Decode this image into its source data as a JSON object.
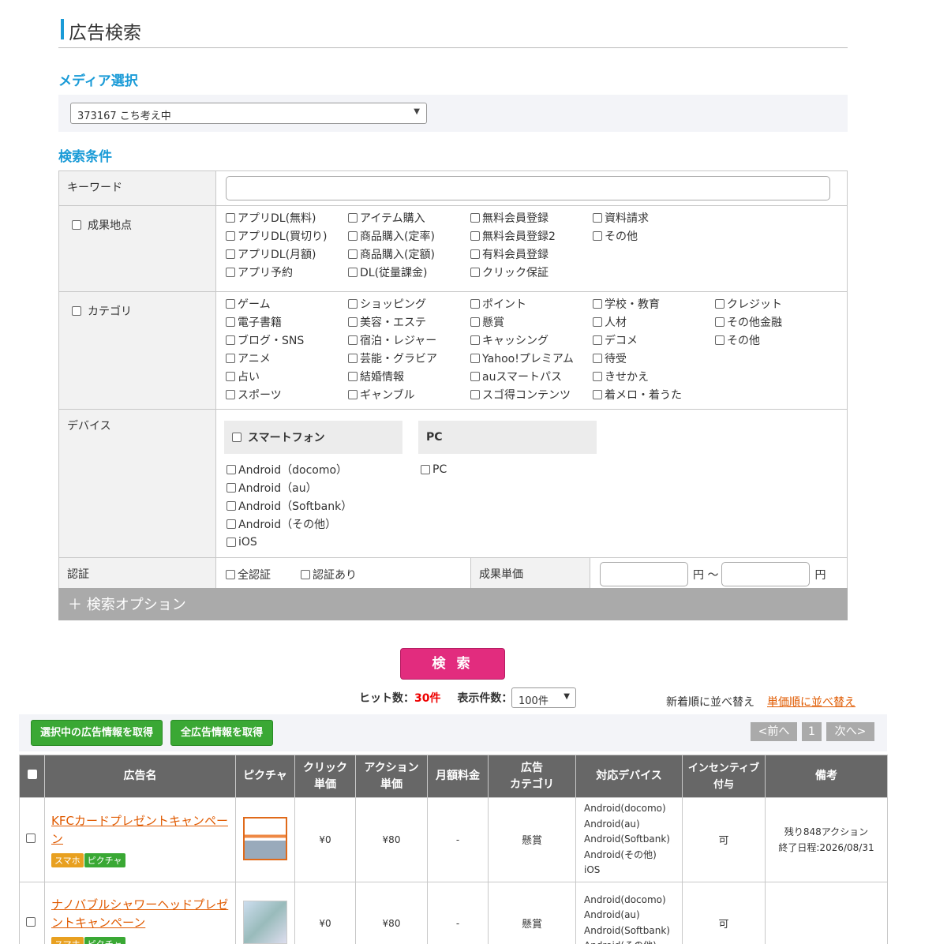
{
  "page_title": "広告検索",
  "media": {
    "heading": "メディア選択",
    "selected": "373167 こち考え中"
  },
  "conditions": {
    "heading": "検索条件",
    "keyword_label": "キーワード",
    "keyword_value": "",
    "outcome_label": "成果地点",
    "outcome_items": [
      "アプリDL(無料)",
      "アイテム購入",
      "無料会員登録",
      "資料請求",
      "アプリDL(買切り)",
      "商品購入(定率)",
      "無料会員登録2",
      "その他",
      "アプリDL(月額)",
      "商品購入(定額)",
      "有料会員登録",
      "",
      "アプリ予約",
      "DL(従量課金)",
      "クリック保証",
      ""
    ],
    "category_label": "カテゴリ",
    "category_items": [
      "ゲーム",
      "ショッピング",
      "ポイント",
      "学校・教育",
      "クレジット",
      "電子書籍",
      "美容・エステ",
      "懸賞",
      "人材",
      "その他金融",
      "ブログ・SNS",
      "宿泊・レジャー",
      "キャッシング",
      "デコメ",
      "その他",
      "アニメ",
      "芸能・グラビア",
      "Yahoo!プレミアム",
      "待受",
      "",
      "占い",
      "結婚情報",
      "auスマートパス",
      "きせかえ",
      "",
      "スポーツ",
      "ギャンブル",
      "スゴ得コンテンツ",
      "着メロ・着うた",
      ""
    ],
    "device_label": "デバイス",
    "smartphone_label": "スマートフォン",
    "smartphone_items": [
      "Android（docomo）",
      "Android（au）",
      "Android（Softbank）",
      "Android（その他）",
      "iOS"
    ],
    "pc_label": "PC",
    "pc_items": [
      "PC"
    ],
    "cert_label": "認証",
    "cert_all": "全認証",
    "cert_yes": "認証あり",
    "price_label": "成果単価",
    "price_from_unit": "円 ～",
    "price_to_unit": "円",
    "options_label": "＋ 検索オプション"
  },
  "search_button": "検 索",
  "results": {
    "hit_label": "ヒット数：",
    "hit_count": "30件",
    "per_page_label": "表示件数：",
    "per_page_value": "100件",
    "sort_new": "新着順に並べ替え",
    "sort_price": "単価順に並べ替え",
    "get_selected": "選択中の広告情報を取得",
    "get_all": "全広告情報を取得",
    "prev": "<前へ",
    "page": "1",
    "next": "次へ>",
    "headers": {
      "name": "広告名",
      "picture": "ピクチャ",
      "click_1": "クリック",
      "click_2": "単価",
      "action_1": "アクション",
      "action_2": "単価",
      "monthly": "月額料金",
      "cat_1": "広告",
      "cat_2": "カテゴリ",
      "devices": "対応デバイス",
      "incentive_1": "インセンティブ",
      "incentive_2": "付与",
      "notes": "備考"
    },
    "rows": [
      {
        "name": "KFCカードプレゼントキャンペーン",
        "tag1": "スマホ",
        "tag2": "ピクチャ",
        "click": "¥0",
        "action": "¥80",
        "monthly": "-",
        "category": "懸賞",
        "devices": [
          "Android(docomo)",
          "Android(au)",
          "Android(Softbank)",
          "Android(その他)",
          "iOS"
        ],
        "incentive": "可",
        "note1": "残り848アクション",
        "note2": "終了日程:2026/08/31"
      },
      {
        "name": "ナノバブルシャワーヘッドプレゼントキャンペーン",
        "tag1": "スマホ",
        "tag2": "ピクチャ",
        "click": "¥0",
        "action": "¥80",
        "monthly": "-",
        "category": "懸賞",
        "devices": [
          "Android(docomo)",
          "Android(au)",
          "Android(Softbank)",
          "Android(その他)"
        ],
        "incentive": "可",
        "note1": "",
        "note2": ""
      }
    ]
  }
}
